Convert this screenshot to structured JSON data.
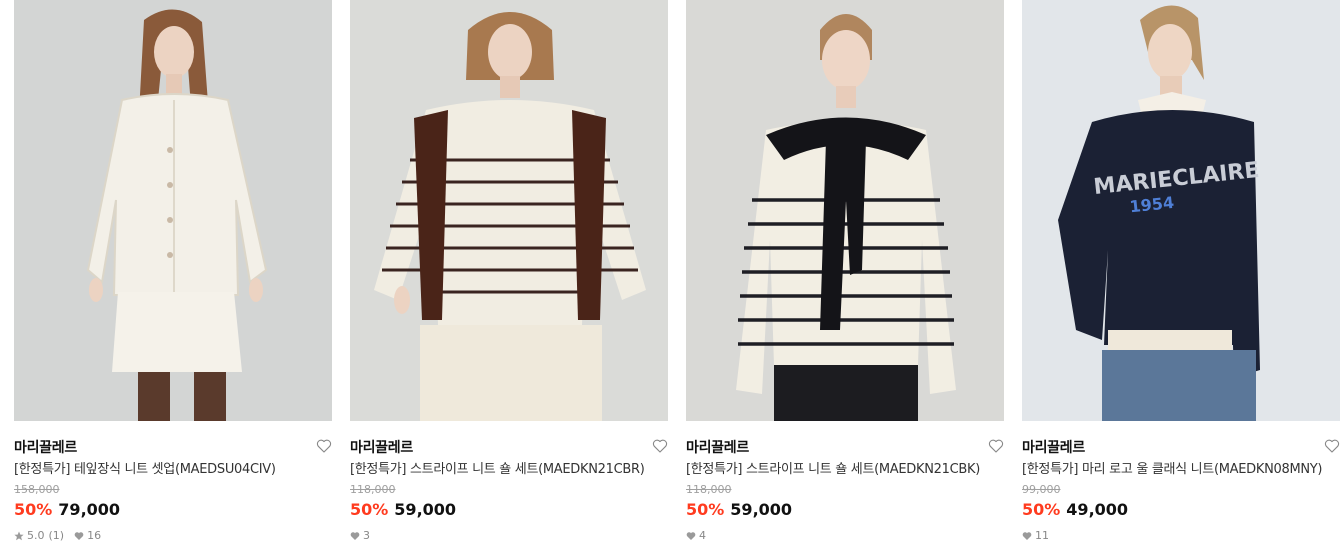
{
  "products": [
    {
      "brand": "마리끌레르",
      "name": "[한정특가] 테잎장식 니트 셋업(MAEDSU04CIV)",
      "original_price": "158,000",
      "discount": "50%",
      "price": "79,000",
      "rating": "5.0",
      "review_count": "(1)",
      "likes": "16",
      "bg": "#d3d5d4"
    },
    {
      "brand": "마리끌레르",
      "name": "[한정특가] 스트라이프 니트 숄 세트(MAEDKN21CBR)",
      "original_price": "118,000",
      "discount": "50%",
      "price": "59,000",
      "likes": "3",
      "bg": "#dadbd8"
    },
    {
      "brand": "마리끌레르",
      "name": "[한정특가] 스트라이프 니트 숄 세트(MAEDKN21CBK)",
      "original_price": "118,000",
      "discount": "50%",
      "price": "59,000",
      "likes": "4",
      "bg": "#d9d9d6"
    },
    {
      "brand": "마리끌레르",
      "name": "[한정특가] 마리 로고 울 클래식 니트(MAEDKN08MNY)",
      "original_price": "99,000",
      "discount": "50%",
      "price": "49,000",
      "likes": "11",
      "bg": "#e2e6ea"
    }
  ],
  "photo_texts": {
    "logo_line1": "MARIECLAIRE",
    "logo_line2": "1954"
  },
  "colors": {
    "discount": "#ff3b1f",
    "strike": "#a0a0a0",
    "meta": "#888888"
  }
}
